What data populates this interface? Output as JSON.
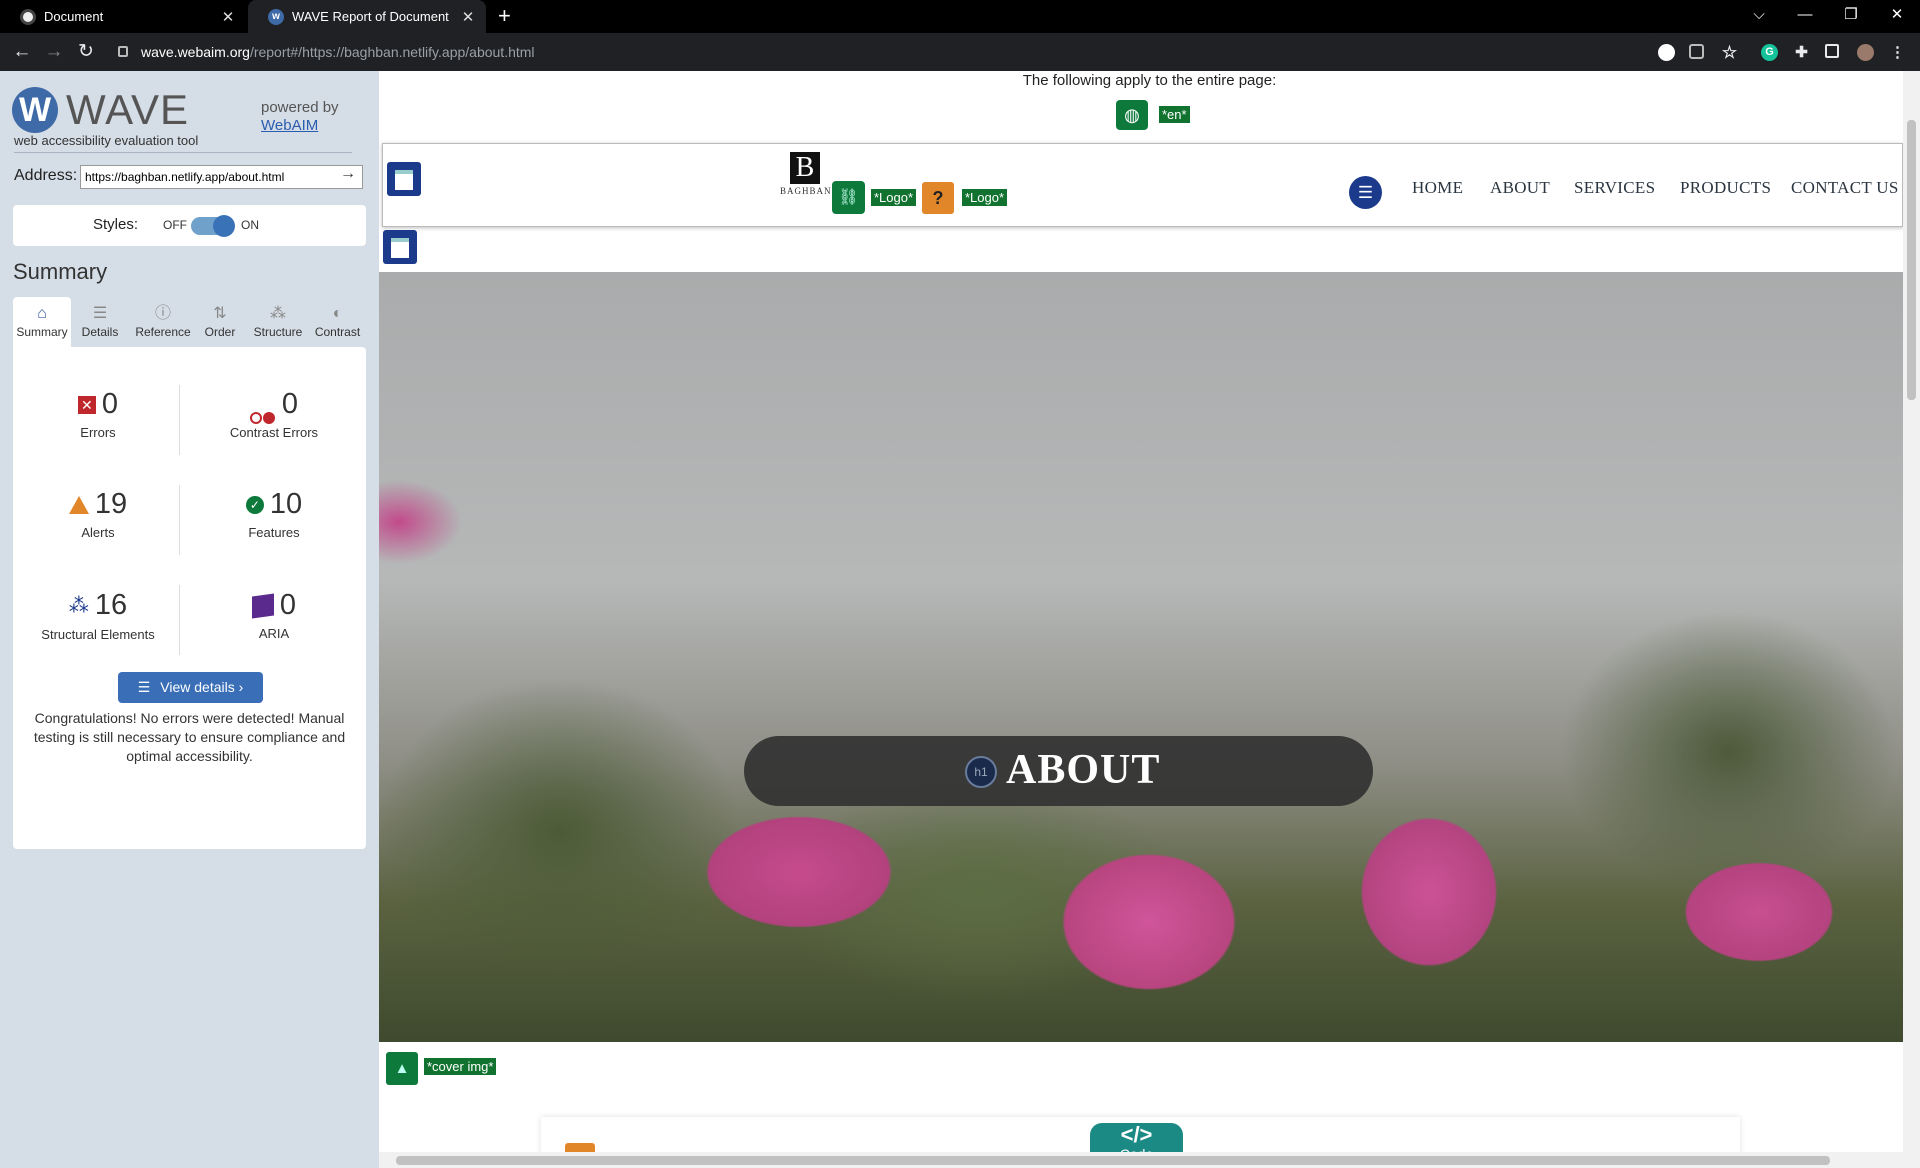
{
  "browser": {
    "tabs": [
      {
        "title": "Document",
        "close": "✕"
      },
      {
        "title": "WAVE Report of Document",
        "close": "✕"
      }
    ],
    "new_tab": "+",
    "window_controls": {
      "dropdown": "⌵",
      "minimize": "—",
      "restore": "❐",
      "close": "✕"
    },
    "nav": {
      "back": "←",
      "forward": "→",
      "reload": "↻"
    },
    "url_domain": "wave.webaim.org",
    "url_rest": "/report#/https://baghban.netlify.app/about.html"
  },
  "wave": {
    "logo_letter": "W",
    "title": "WAVE",
    "tagline": "web accessibility evaluation tool",
    "powered_by": "powered by",
    "webaim": "WebAIM",
    "address_label": "Address:",
    "address_value": "https://baghban.netlify.app/about.html",
    "address_go": "→",
    "styles_label": "Styles:",
    "styles_off": "OFF",
    "styles_on": "ON",
    "summary_heading": "Summary",
    "tabs": [
      "Summary",
      "Details",
      "Reference",
      "Order",
      "Structure",
      "Contrast"
    ],
    "stats": {
      "errors": {
        "value": "0",
        "label": "Errors"
      },
      "contrast_errors": {
        "value": "0",
        "label": "Contrast Errors"
      },
      "alerts": {
        "value": "19",
        "label": "Alerts"
      },
      "features": {
        "value": "10",
        "label": "Features"
      },
      "structural": {
        "value": "16",
        "label": "Structural Elements"
      },
      "aria": {
        "value": "0",
        "label": "ARIA"
      }
    },
    "view_details": "View details ›",
    "congrats": "Congratulations! No errors were detected! Manual testing is still necessary to ensure compliance and optimal accessibility.",
    "colors": {
      "sidebar_bg": "#d5dde6",
      "accent": "#3a6fb8",
      "feature_green": "#0d7a3c",
      "alert_orange": "#e2862a",
      "structure_blue": "#1b3a8c"
    }
  },
  "page": {
    "entire_page_note": "The following apply to the entire page:",
    "lang_label": "*en*",
    "brand_letter": "B",
    "brand_name": "BAGHBAN",
    "logo_alt_1": "*Logo*",
    "logo_alt_2": "*Logo*",
    "alert_symbol": "?",
    "nav_links": [
      "HOME",
      "ABOUT",
      "SERVICES",
      "PRODUCTS",
      "CONTACT US"
    ],
    "h1_badge": "h1",
    "hero_title": "ABOUT",
    "cover_alt": "*cover img*",
    "code_icon": "</>",
    "code_label": "Code"
  }
}
